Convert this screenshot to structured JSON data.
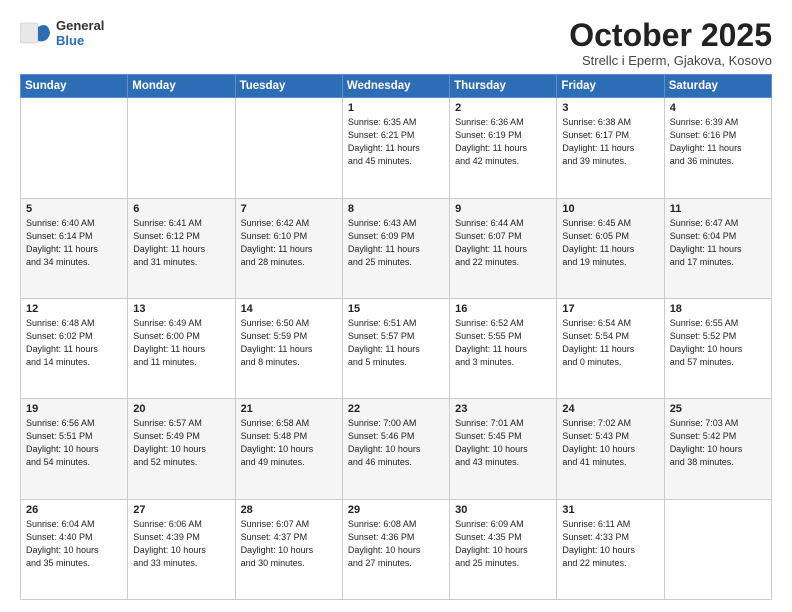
{
  "header": {
    "logo_general": "General",
    "logo_blue": "Blue",
    "month": "October 2025",
    "location": "Strellc i Eperm, Gjakova, Kosovo"
  },
  "days_of_week": [
    "Sunday",
    "Monday",
    "Tuesday",
    "Wednesday",
    "Thursday",
    "Friday",
    "Saturday"
  ],
  "weeks": [
    [
      {
        "day": "",
        "text": ""
      },
      {
        "day": "",
        "text": ""
      },
      {
        "day": "",
        "text": ""
      },
      {
        "day": "1",
        "text": "Sunrise: 6:35 AM\nSunset: 6:21 PM\nDaylight: 11 hours\nand 45 minutes."
      },
      {
        "day": "2",
        "text": "Sunrise: 6:36 AM\nSunset: 6:19 PM\nDaylight: 11 hours\nand 42 minutes."
      },
      {
        "day": "3",
        "text": "Sunrise: 6:38 AM\nSunset: 6:17 PM\nDaylight: 11 hours\nand 39 minutes."
      },
      {
        "day": "4",
        "text": "Sunrise: 6:39 AM\nSunset: 6:16 PM\nDaylight: 11 hours\nand 36 minutes."
      }
    ],
    [
      {
        "day": "5",
        "text": "Sunrise: 6:40 AM\nSunset: 6:14 PM\nDaylight: 11 hours\nand 34 minutes."
      },
      {
        "day": "6",
        "text": "Sunrise: 6:41 AM\nSunset: 6:12 PM\nDaylight: 11 hours\nand 31 minutes."
      },
      {
        "day": "7",
        "text": "Sunrise: 6:42 AM\nSunset: 6:10 PM\nDaylight: 11 hours\nand 28 minutes."
      },
      {
        "day": "8",
        "text": "Sunrise: 6:43 AM\nSunset: 6:09 PM\nDaylight: 11 hours\nand 25 minutes."
      },
      {
        "day": "9",
        "text": "Sunrise: 6:44 AM\nSunset: 6:07 PM\nDaylight: 11 hours\nand 22 minutes."
      },
      {
        "day": "10",
        "text": "Sunrise: 6:45 AM\nSunset: 6:05 PM\nDaylight: 11 hours\nand 19 minutes."
      },
      {
        "day": "11",
        "text": "Sunrise: 6:47 AM\nSunset: 6:04 PM\nDaylight: 11 hours\nand 17 minutes."
      }
    ],
    [
      {
        "day": "12",
        "text": "Sunrise: 6:48 AM\nSunset: 6:02 PM\nDaylight: 11 hours\nand 14 minutes."
      },
      {
        "day": "13",
        "text": "Sunrise: 6:49 AM\nSunset: 6:00 PM\nDaylight: 11 hours\nand 11 minutes."
      },
      {
        "day": "14",
        "text": "Sunrise: 6:50 AM\nSunset: 5:59 PM\nDaylight: 11 hours\nand 8 minutes."
      },
      {
        "day": "15",
        "text": "Sunrise: 6:51 AM\nSunset: 5:57 PM\nDaylight: 11 hours\nand 5 minutes."
      },
      {
        "day": "16",
        "text": "Sunrise: 6:52 AM\nSunset: 5:55 PM\nDaylight: 11 hours\nand 3 minutes."
      },
      {
        "day": "17",
        "text": "Sunrise: 6:54 AM\nSunset: 5:54 PM\nDaylight: 11 hours\nand 0 minutes."
      },
      {
        "day": "18",
        "text": "Sunrise: 6:55 AM\nSunset: 5:52 PM\nDaylight: 10 hours\nand 57 minutes."
      }
    ],
    [
      {
        "day": "19",
        "text": "Sunrise: 6:56 AM\nSunset: 5:51 PM\nDaylight: 10 hours\nand 54 minutes."
      },
      {
        "day": "20",
        "text": "Sunrise: 6:57 AM\nSunset: 5:49 PM\nDaylight: 10 hours\nand 52 minutes."
      },
      {
        "day": "21",
        "text": "Sunrise: 6:58 AM\nSunset: 5:48 PM\nDaylight: 10 hours\nand 49 minutes."
      },
      {
        "day": "22",
        "text": "Sunrise: 7:00 AM\nSunset: 5:46 PM\nDaylight: 10 hours\nand 46 minutes."
      },
      {
        "day": "23",
        "text": "Sunrise: 7:01 AM\nSunset: 5:45 PM\nDaylight: 10 hours\nand 43 minutes."
      },
      {
        "day": "24",
        "text": "Sunrise: 7:02 AM\nSunset: 5:43 PM\nDaylight: 10 hours\nand 41 minutes."
      },
      {
        "day": "25",
        "text": "Sunrise: 7:03 AM\nSunset: 5:42 PM\nDaylight: 10 hours\nand 38 minutes."
      }
    ],
    [
      {
        "day": "26",
        "text": "Sunrise: 6:04 AM\nSunset: 4:40 PM\nDaylight: 10 hours\nand 35 minutes."
      },
      {
        "day": "27",
        "text": "Sunrise: 6:06 AM\nSunset: 4:39 PM\nDaylight: 10 hours\nand 33 minutes."
      },
      {
        "day": "28",
        "text": "Sunrise: 6:07 AM\nSunset: 4:37 PM\nDaylight: 10 hours\nand 30 minutes."
      },
      {
        "day": "29",
        "text": "Sunrise: 6:08 AM\nSunset: 4:36 PM\nDaylight: 10 hours\nand 27 minutes."
      },
      {
        "day": "30",
        "text": "Sunrise: 6:09 AM\nSunset: 4:35 PM\nDaylight: 10 hours\nand 25 minutes."
      },
      {
        "day": "31",
        "text": "Sunrise: 6:11 AM\nSunset: 4:33 PM\nDaylight: 10 hours\nand 22 minutes."
      },
      {
        "day": "",
        "text": ""
      }
    ]
  ]
}
